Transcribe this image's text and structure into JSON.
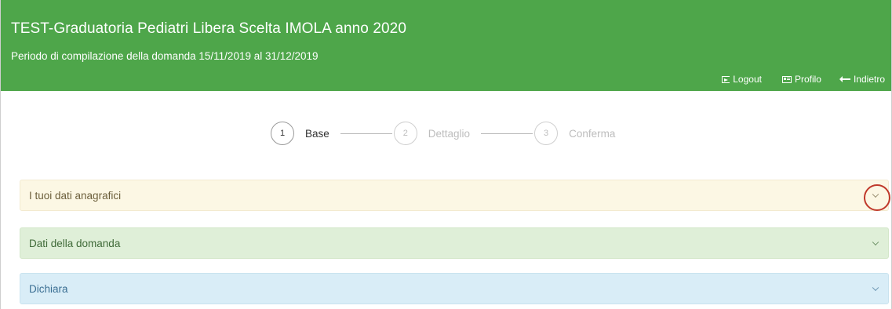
{
  "header": {
    "title": "TEST-Graduatoria Pediatri Libera Scelta IMOLA anno 2020",
    "subtitle": "Periodo di compilazione della domanda 15/11/2019 al 31/12/2019",
    "actions": {
      "logout": "Logout",
      "profile": "Profilo",
      "back": "Indietro"
    },
    "background_color": "#4ea64a"
  },
  "stepper": {
    "steps": [
      {
        "number": "1",
        "label": "Base",
        "state": "active"
      },
      {
        "number": "2",
        "label": "Dettaglio",
        "state": "inactive"
      },
      {
        "number": "3",
        "label": "Conferma",
        "state": "inactive"
      }
    ]
  },
  "panels": [
    {
      "title": "I tuoi dati anagrafici",
      "color": "#fcf7e4",
      "icon": "chevron-down-icon",
      "highlighted": true
    },
    {
      "title": "Dati della domanda",
      "color": "#dfefd8",
      "icon": "chevron-down-icon"
    },
    {
      "title": "Dichiara",
      "color": "#d9edf7",
      "icon": "chevron-down-icon"
    }
  ],
  "annotation_color": "#c0392b"
}
